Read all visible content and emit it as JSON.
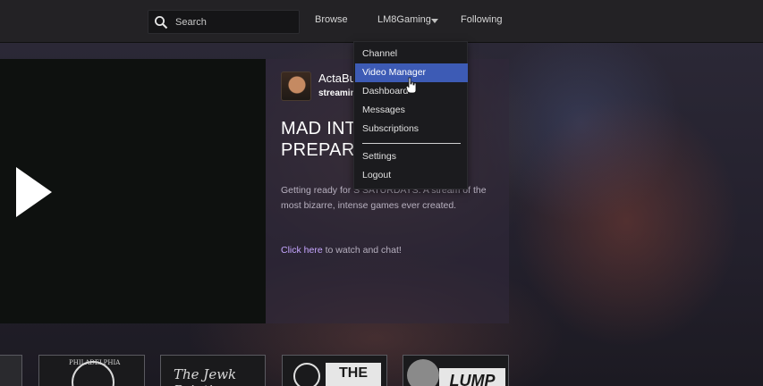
{
  "nav": {
    "search_placeholder": "Search",
    "browse": "Browse",
    "user": "LM8Gaming",
    "following": "Following"
  },
  "channel": {
    "name": "ActaBu",
    "status": "streamin",
    "title_line1": "MAD INT",
    "title_line2": "PREPAR",
    "description": "Getting ready for S SATURDAYS. A stream of the most bizarre, intense games ever created.",
    "watch_link": "Click here",
    "watch_rest": " to watch and chat!"
  },
  "dropdown": {
    "items": [
      "Channel",
      "Video Manager",
      "Dashboard",
      "Messages",
      "Subscriptions"
    ],
    "items2": [
      "Settings",
      "Logout"
    ],
    "active": "Video Manager"
  },
  "thumbnails": {
    "t1_text": "PHILADELPHIA",
    "t2_text": "The Jewk Painting",
    "t3_text": "THE",
    "t4_text": "LUMP"
  },
  "icons": {
    "search": "search-icon",
    "caret": "caret-down-icon",
    "play": "play-icon",
    "cursor": "hand-cursor-icon"
  },
  "colors": {
    "menu_active": "#3d5bb5",
    "link": "#c6a6ff"
  }
}
